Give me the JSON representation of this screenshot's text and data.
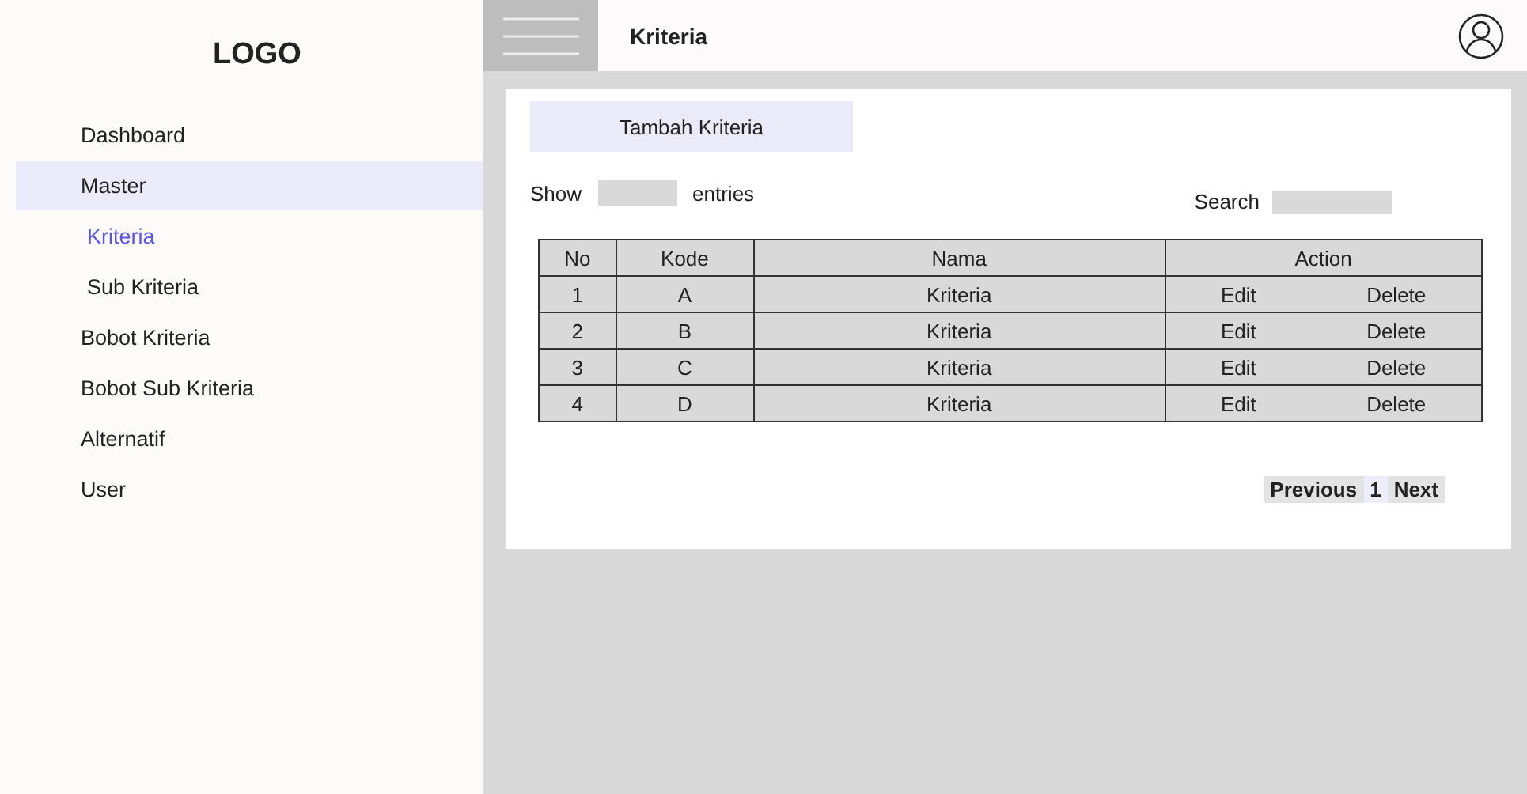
{
  "sidebar": {
    "logo": "LOGO",
    "items": [
      {
        "label": "Dashboard",
        "selected": false
      },
      {
        "label": "Master",
        "selected": true,
        "children": [
          {
            "label": "Kriteria",
            "selected": true
          },
          {
            "label": "Sub Kriteria",
            "selected": false
          }
        ]
      },
      {
        "label": "Bobot Kriteria",
        "selected": false
      },
      {
        "label": "Bobot Sub Kriteria",
        "selected": false
      },
      {
        "label": "Alternatif",
        "selected": false
      },
      {
        "label": "User",
        "selected": false
      }
    ]
  },
  "topbar": {
    "title": "Kriteria"
  },
  "add_button": "Tambah Kriteria",
  "show_entries": {
    "before": "Show",
    "after": "entries"
  },
  "search": {
    "label": "Search"
  },
  "table": {
    "columns": [
      "No",
      "Kode",
      "Nama",
      "Action"
    ],
    "rows": [
      {
        "no": "1",
        "kode": "A",
        "nama": "Kriteria",
        "actions": [
          "Edit",
          "Delete"
        ]
      },
      {
        "no": "2",
        "kode": "B",
        "nama": "Kriteria",
        "actions": [
          "Edit",
          "Delete"
        ]
      },
      {
        "no": "3",
        "kode": "C",
        "nama": "Kriteria",
        "actions": [
          "Edit",
          "Delete"
        ]
      },
      {
        "no": "4",
        "kode": "D",
        "nama": "Kriteria",
        "actions": [
          "Edit",
          "Delete"
        ]
      }
    ]
  },
  "pagination": [
    {
      "label": "Previous",
      "selected": false
    },
    {
      "label": "1",
      "selected": true
    },
    {
      "label": "Next",
      "selected": false
    }
  ]
}
